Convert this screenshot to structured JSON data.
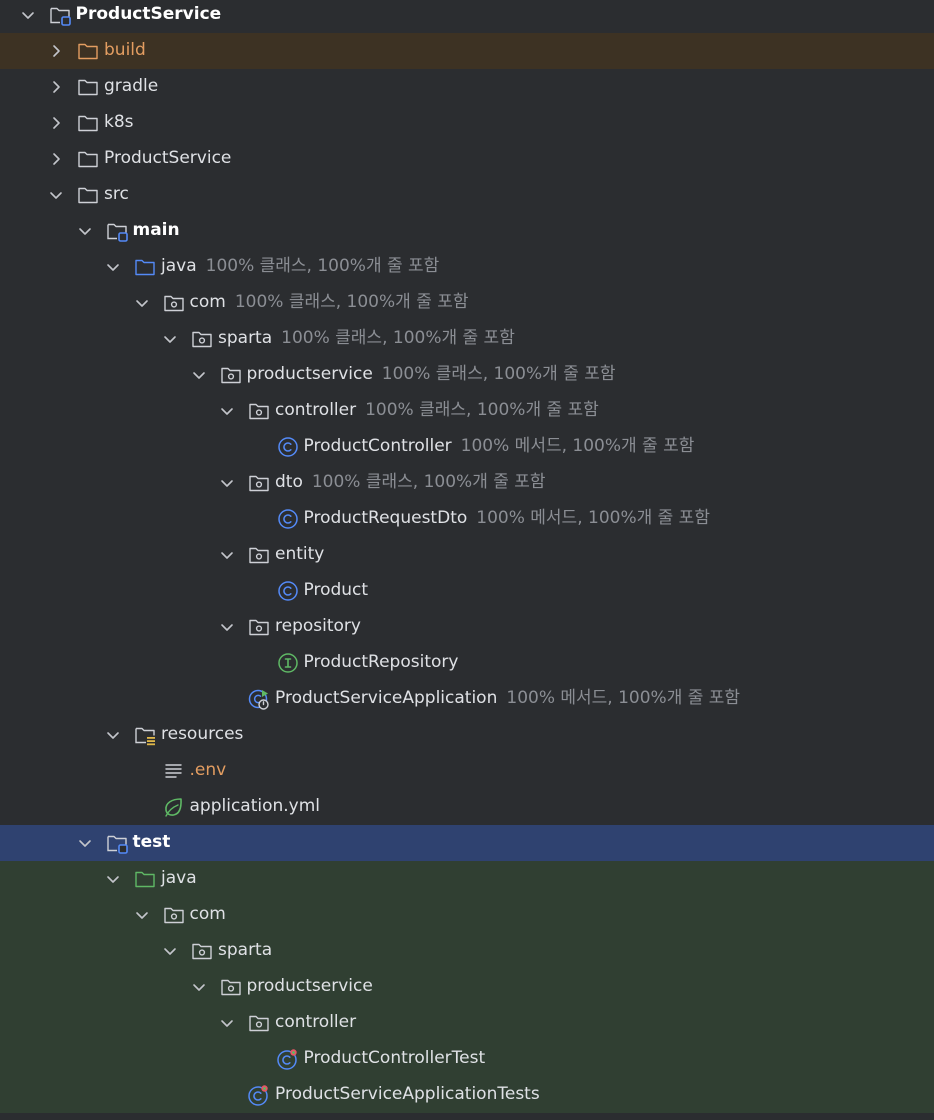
{
  "colors": {
    "background": "#2b2d30",
    "excluded_row": "#3d3223",
    "selected_row": "#2f4270",
    "test_row": "#303f32",
    "text": "#dfe1e5",
    "coverage_text": "#8b8e94",
    "excluded_text": "#e39d61",
    "class_icon": "#548af7",
    "interface_icon": "#5fb865",
    "test_folder": "#5fb865",
    "source_folder": "#548af7"
  },
  "tree": [
    {
      "label": "ProductService",
      "depth": 0,
      "expanded": true,
      "icon": "module-folder-icon",
      "bold": true,
      "coverage": ""
    },
    {
      "label": "build",
      "depth": 1,
      "expanded": false,
      "icon": "excluded-folder-icon",
      "row": "excluded",
      "coverage": ""
    },
    {
      "label": "gradle",
      "depth": 1,
      "expanded": false,
      "icon": "folder-icon",
      "coverage": ""
    },
    {
      "label": "k8s",
      "depth": 1,
      "expanded": false,
      "icon": "folder-icon",
      "coverage": ""
    },
    {
      "label": "ProductService",
      "depth": 1,
      "expanded": false,
      "icon": "folder-icon",
      "coverage": ""
    },
    {
      "label": "src",
      "depth": 1,
      "expanded": true,
      "icon": "folder-icon",
      "coverage": ""
    },
    {
      "label": "main",
      "depth": 2,
      "expanded": true,
      "icon": "module-folder-icon",
      "bold": true,
      "coverage": ""
    },
    {
      "label": "java",
      "depth": 3,
      "expanded": true,
      "icon": "source-folder-icon",
      "coverage": "100% 클래스, 100%개 줄 포함"
    },
    {
      "label": "com",
      "depth": 4,
      "expanded": true,
      "icon": "package-icon",
      "coverage": "100% 클래스, 100%개 줄 포함"
    },
    {
      "label": "sparta",
      "depth": 5,
      "expanded": true,
      "icon": "package-icon",
      "coverage": "100% 클래스, 100%개 줄 포함"
    },
    {
      "label": "productservice",
      "depth": 6,
      "expanded": true,
      "icon": "package-icon",
      "coverage": "100% 클래스, 100%개 줄 포함"
    },
    {
      "label": "controller",
      "depth": 7,
      "expanded": true,
      "icon": "package-icon",
      "coverage": "100% 클래스, 100%개 줄 포함"
    },
    {
      "label": "ProductController",
      "depth": 8,
      "icon": "class-icon",
      "coverage": "100% 메서드, 100%개 줄 포함"
    },
    {
      "label": "dto",
      "depth": 7,
      "expanded": true,
      "icon": "package-icon",
      "coverage": "100% 클래스, 100%개 줄 포함"
    },
    {
      "label": "ProductRequestDto",
      "depth": 8,
      "icon": "class-icon",
      "coverage": "100% 메서드, 100%개 줄 포함"
    },
    {
      "label": "entity",
      "depth": 7,
      "expanded": true,
      "icon": "package-icon",
      "coverage": ""
    },
    {
      "label": "Product",
      "depth": 8,
      "icon": "class-icon",
      "coverage": ""
    },
    {
      "label": "repository",
      "depth": 7,
      "expanded": true,
      "icon": "package-icon",
      "coverage": ""
    },
    {
      "label": "ProductRepository",
      "depth": 8,
      "icon": "interface-icon",
      "coverage": ""
    },
    {
      "label": "ProductServiceApplication",
      "depth": 7,
      "icon": "spring-boot-app-icon",
      "coverage": "100% 메서드, 100%개 줄 포함"
    },
    {
      "label": "resources",
      "depth": 3,
      "expanded": true,
      "icon": "resources-folder-icon",
      "coverage": ""
    },
    {
      "label": ".env",
      "depth": 4,
      "icon": "text-file-icon",
      "env": true,
      "coverage": ""
    },
    {
      "label": "application.yml",
      "depth": 4,
      "icon": "spring-config-icon",
      "coverage": ""
    },
    {
      "label": "test",
      "depth": 2,
      "expanded": true,
      "icon": "module-folder-icon",
      "bold": true,
      "row": "selected",
      "coverage": ""
    },
    {
      "label": "java",
      "depth": 3,
      "expanded": true,
      "icon": "test-source-folder-icon",
      "row": "test",
      "coverage": ""
    },
    {
      "label": "com",
      "depth": 4,
      "expanded": true,
      "icon": "package-icon",
      "row": "test",
      "coverage": ""
    },
    {
      "label": "sparta",
      "depth": 5,
      "expanded": true,
      "icon": "package-icon",
      "row": "test",
      "coverage": ""
    },
    {
      "label": "productservice",
      "depth": 6,
      "expanded": true,
      "icon": "package-icon",
      "row": "test",
      "coverage": ""
    },
    {
      "label": "controller",
      "depth": 7,
      "expanded": true,
      "icon": "package-icon",
      "row": "test",
      "coverage": ""
    },
    {
      "label": "ProductControllerTest",
      "depth": 8,
      "icon": "test-class-icon",
      "row": "test",
      "coverage": ""
    },
    {
      "label": "ProductServiceApplicationTests",
      "depth": 7,
      "icon": "test-class-icon",
      "row": "test",
      "coverage": ""
    }
  ]
}
